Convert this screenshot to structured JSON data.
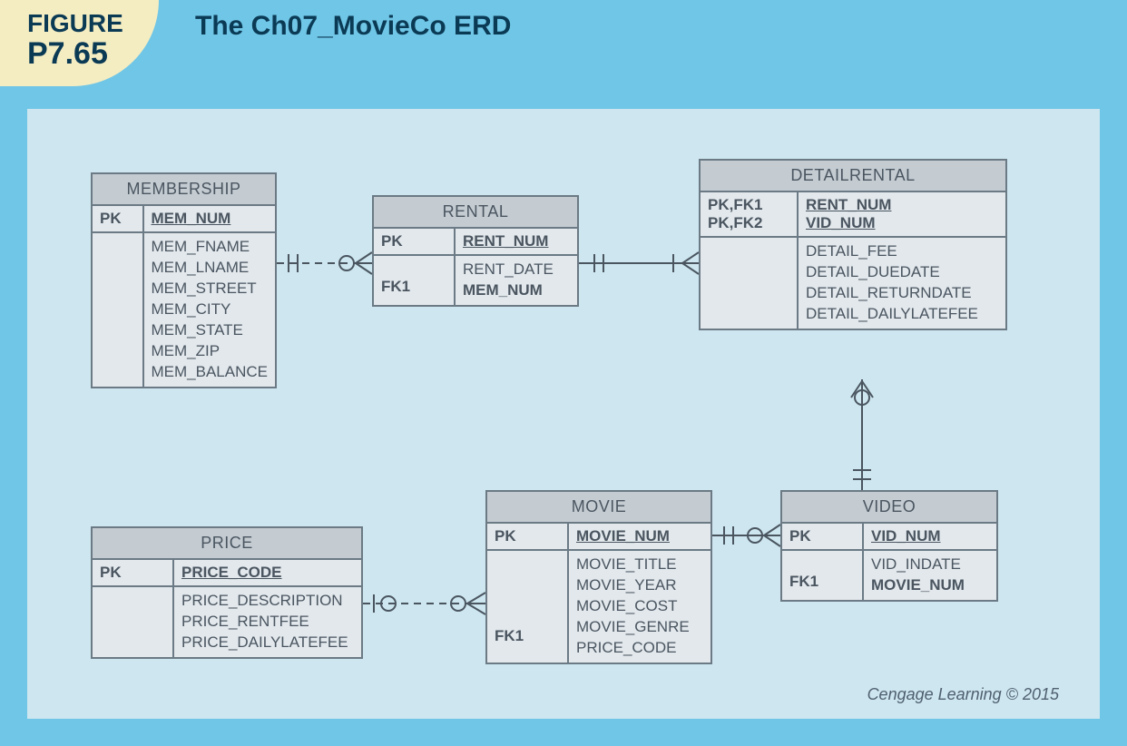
{
  "figure": {
    "label": "FIGURE",
    "number": "P7.65"
  },
  "title": "The Ch07_MovieCo ERD",
  "copyright": "Cengage Learning © 2015",
  "entities": {
    "membership": {
      "name": "MEMBERSHIP",
      "pk_label": "PK",
      "pk_field": "MEM_NUM",
      "attrs": [
        "MEM_FNAME",
        "MEM_LNAME",
        "MEM_STREET",
        "MEM_CITY",
        "MEM_STATE",
        "MEM_ZIP",
        "MEM_BALANCE"
      ]
    },
    "rental": {
      "name": "RENTAL",
      "pk_label": "PK",
      "pk_field": "RENT_NUM",
      "attr1": "RENT_DATE",
      "fk1_label": "FK1",
      "fk1_field": "MEM_NUM"
    },
    "detailrental": {
      "name": "DETAILRENTAL",
      "pk1_label": "PK,FK1",
      "pk1_field": "RENT_NUM",
      "pk2_label": "PK,FK2",
      "pk2_field": "VID_NUM",
      "attrs": [
        "DETAIL_FEE",
        "DETAIL_DUEDATE",
        "DETAIL_RETURNDATE",
        "DETAIL_DAILYLATEFEE"
      ]
    },
    "price": {
      "name": "PRICE",
      "pk_label": "PK",
      "pk_field": "PRICE_CODE",
      "attrs": [
        "PRICE_DESCRIPTION",
        "PRICE_RENTFEE",
        "PRICE_DAILYLATEFEE"
      ]
    },
    "movie": {
      "name": "MOVIE",
      "pk_label": "PK",
      "pk_field": "MOVIE_NUM",
      "attrs": [
        "MOVIE_TITLE",
        "MOVIE_YEAR",
        "MOVIE_COST",
        "MOVIE_GENRE"
      ],
      "fk1_label": "FK1",
      "fk1_field": "PRICE_CODE"
    },
    "video": {
      "name": "VIDEO",
      "pk_label": "PK",
      "pk_field": "VID_NUM",
      "attr1": "VID_INDATE",
      "fk1_label": "FK1",
      "fk1_field": "MOVIE_NUM"
    }
  },
  "relationships": [
    {
      "from": "MEMBERSHIP",
      "to": "RENTAL",
      "from_card": "1..1",
      "to_card": "0..*",
      "style": "dashed"
    },
    {
      "from": "RENTAL",
      "to": "DETAILRENTAL",
      "from_card": "1..1",
      "to_card": "1..*",
      "style": "solid"
    },
    {
      "from": "DETAILRENTAL",
      "to": "VIDEO",
      "from_card": "0..*",
      "to_card": "1..1",
      "style": "solid"
    },
    {
      "from": "MOVIE",
      "to": "VIDEO",
      "from_card": "1..1",
      "to_card": "0..*",
      "style": "solid"
    },
    {
      "from": "PRICE",
      "to": "MOVIE",
      "from_card": "0..1",
      "to_card": "0..*",
      "style": "dashed"
    }
  ]
}
